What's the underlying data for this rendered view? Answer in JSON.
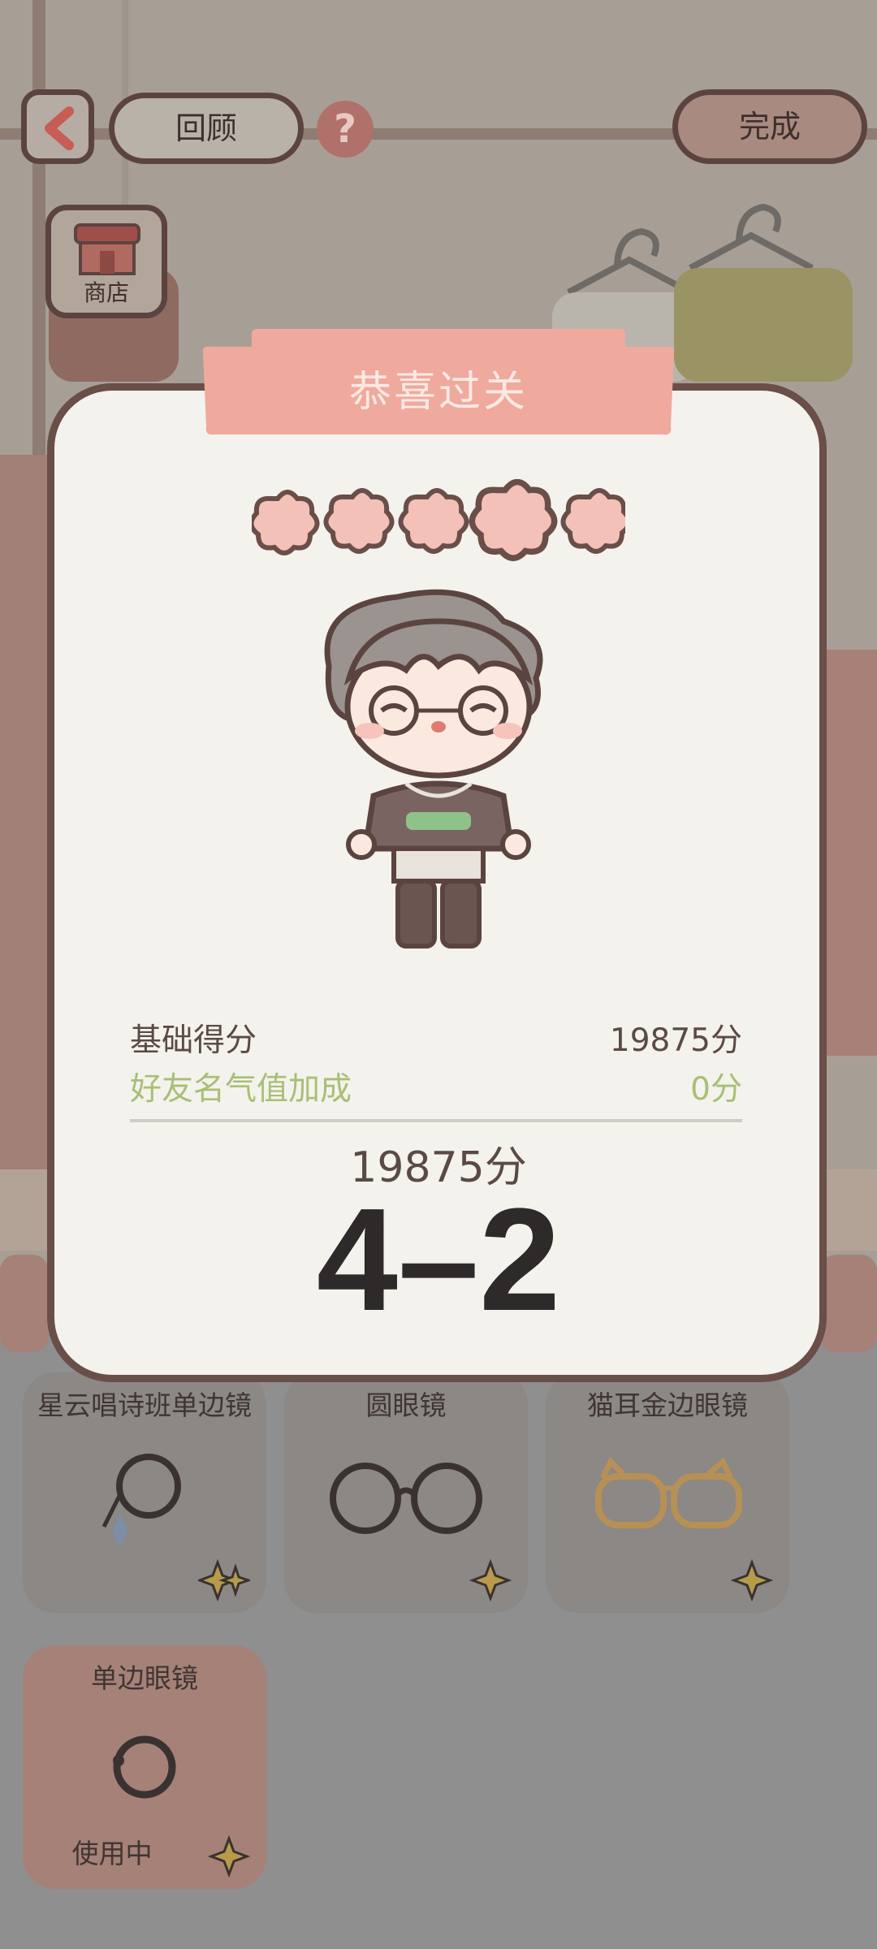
{
  "topbar": {
    "back_icon": "chevron-left-icon",
    "review_label": "回顾",
    "help_label": "?",
    "done_label": "完成"
  },
  "shop": {
    "icon": "shop-icon",
    "label": "商店"
  },
  "modal": {
    "title": "恭喜过关",
    "stars_filled": 5,
    "stars_total": 5,
    "base_score_label": "基础得分",
    "base_score_value": "19875分",
    "bonus_label": "好友名气值加成",
    "bonus_value": "0分",
    "total_score": "19875分",
    "level": "4–2"
  },
  "items": [
    {
      "name": "星云唱诗班单边镜",
      "icon": "monocle-chain-icon"
    },
    {
      "name": "圆眼镜",
      "icon": "round-glasses-icon"
    },
    {
      "name": "猫耳金边眼镜",
      "icon": "cat-ear-glasses-icon"
    },
    {
      "name": "单边眼镜",
      "icon": "monocle-icon",
      "status": "使用中"
    }
  ],
  "colors": {
    "accent": "#f0a99d",
    "frame": "#6a4e48",
    "bonus_text": "#a8bf75",
    "overlay": "#8f8f8f"
  }
}
